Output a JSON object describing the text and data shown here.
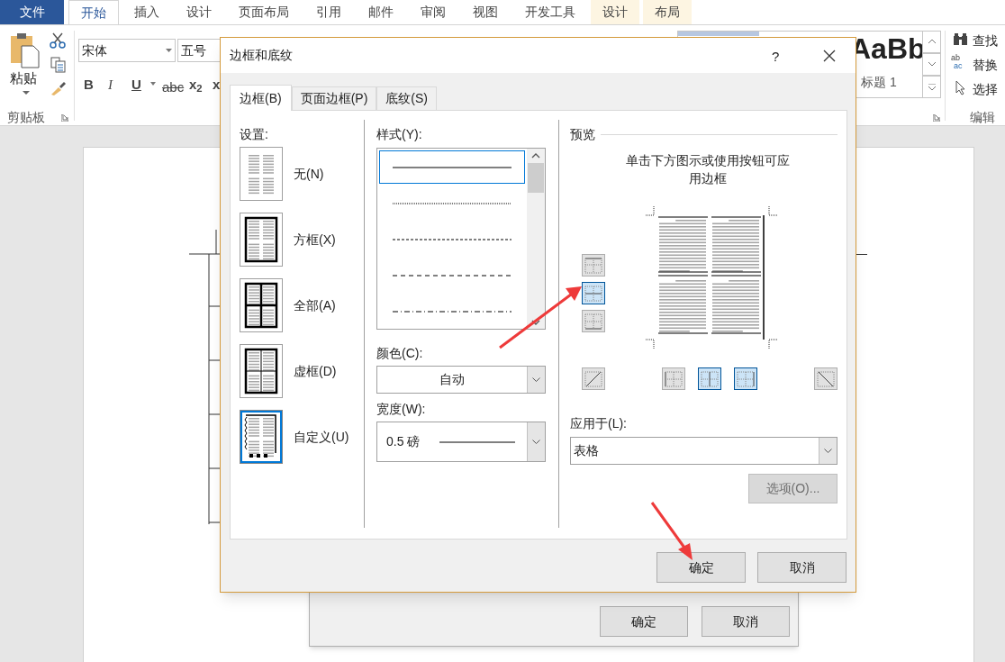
{
  "ribbon": {
    "file_tab": "文件",
    "tabs": [
      {
        "label": "开始",
        "selected": true,
        "contextual": false
      },
      {
        "label": "插入",
        "selected": false,
        "contextual": false
      },
      {
        "label": "设计",
        "selected": false,
        "contextual": false
      },
      {
        "label": "页面布局",
        "selected": false,
        "contextual": false
      },
      {
        "label": "引用",
        "selected": false,
        "contextual": false
      },
      {
        "label": "邮件",
        "selected": false,
        "contextual": false
      },
      {
        "label": "审阅",
        "selected": false,
        "contextual": false
      },
      {
        "label": "视图",
        "selected": false,
        "contextual": false
      },
      {
        "label": "开发工具",
        "selected": false,
        "contextual": false
      },
      {
        "label": "设计",
        "selected": false,
        "contextual": true
      },
      {
        "label": "布局",
        "selected": false,
        "contextual": true
      }
    ],
    "clipboard": {
      "paste": "粘贴",
      "group": "剪贴板"
    },
    "font": {
      "name": "宋体",
      "size": "五号",
      "format": [
        {
          "kind": "bold",
          "text": "B"
        },
        {
          "kind": "italic",
          "text": "I"
        },
        {
          "kind": "underline",
          "text": "U"
        },
        {
          "kind": "strike",
          "text": "abc"
        },
        {
          "kind": "sub",
          "text": "x$_{2}$"
        },
        {
          "kind": "sup",
          "text": "x"
        }
      ]
    },
    "styles": {
      "preview": "AaBb",
      "name": "标题 1"
    },
    "editing": {
      "find": "查找",
      "replace": "替换",
      "replace_icon": [
        "ab",
        "ac"
      ],
      "select": "选择",
      "group": "编辑"
    }
  },
  "back_dialog": {
    "buttons": [
      "确定",
      "取消"
    ]
  },
  "dialog": {
    "title": "边框和底纹",
    "help": "?",
    "tabs": [
      {
        "label": "边框(B)",
        "selected": true
      },
      {
        "label": "页面边框(P)",
        "selected": false
      },
      {
        "label": "底纹(S)",
        "selected": false
      }
    ],
    "settings": {
      "label": "设置:",
      "options": [
        {
          "label": "无(N)",
          "kind": "none",
          "selected": false
        },
        {
          "label": "方框(X)",
          "kind": "box",
          "selected": false
        },
        {
          "label": "全部(A)",
          "kind": "all",
          "selected": false
        },
        {
          "label": "虚框(D)",
          "kind": "grid",
          "selected": false
        },
        {
          "label": "自定义(U)",
          "kind": "custom",
          "selected": true
        }
      ]
    },
    "style": {
      "label": "样式(Y):",
      "lines": [
        {
          "kind": "solid",
          "selected": true
        },
        {
          "kind": "dotted",
          "selected": false
        },
        {
          "kind": "dashed",
          "selected": false
        },
        {
          "kind": "long-dashed",
          "selected": false
        },
        {
          "kind": "dash-dot",
          "selected": false
        }
      ]
    },
    "color": {
      "label": "颜色(C):",
      "value": "自动"
    },
    "width": {
      "label": "宽度(W):",
      "value": "0.5 磅"
    },
    "preview": {
      "label": "预览",
      "hint": "单击下方图示或使用按钮可应用边框",
      "side_buttons": [
        {
          "kind": "top",
          "on": false
        },
        {
          "kind": "inside-h",
          "on": true
        },
        {
          "kind": "bottom",
          "on": false
        }
      ],
      "bottom_buttons": [
        {
          "kind": "diag-up",
          "on": false
        },
        {
          "kind": "left",
          "on": false
        },
        {
          "kind": "inside-v",
          "on": true
        },
        {
          "kind": "right",
          "on": true
        },
        {
          "kind": "diag-down",
          "on": false
        }
      ]
    },
    "apply_to": {
      "label": "应用于(L):",
      "value": "表格"
    },
    "options_button": {
      "label": "选项(O)...",
      "disabled": true
    },
    "buttons": [
      "确定",
      "取消"
    ]
  }
}
